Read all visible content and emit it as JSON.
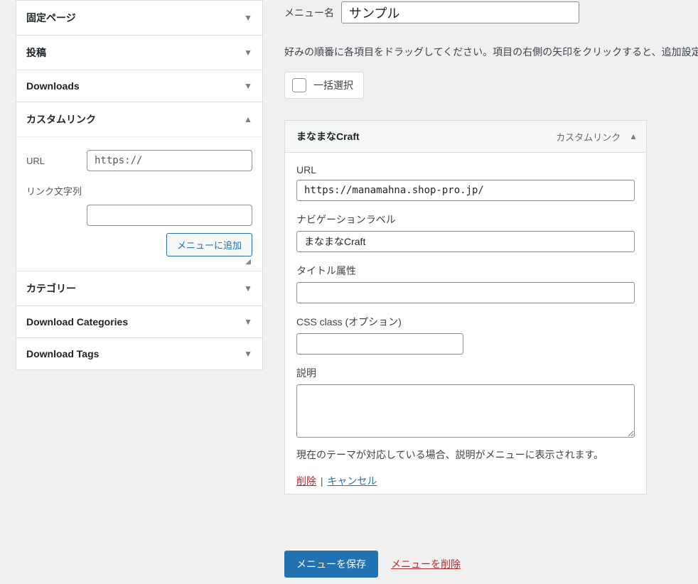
{
  "sidebar": {
    "pages": {
      "title": "固定ページ"
    },
    "posts": {
      "title": "投稿"
    },
    "downloads": {
      "title": "Downloads"
    },
    "custom_link": {
      "title": "カスタムリンク",
      "url_label": "URL",
      "url_value": "https://",
      "link_text_label": "リンク文字列",
      "link_text_value": "",
      "add_button": "メニューに追加"
    },
    "categories": {
      "title": "カテゴリー"
    },
    "download_categories": {
      "title": "Download Categories"
    },
    "download_tags": {
      "title": "Download Tags"
    }
  },
  "main": {
    "menu_name_label": "メニュー名",
    "menu_name_value": "サンプル",
    "instruction": "好みの順番に各項目をドラッグしてください。項目の右側の矢印をクリックすると、追加設定オプションを表示できます。",
    "bulk_select": "一括選択",
    "item": {
      "title": "まなまなCraft",
      "type": "カスタムリンク",
      "fields": {
        "url_label": "URL",
        "url_value": "https://manamahna.shop-pro.jp/",
        "nav_label_label": "ナビゲーションラベル",
        "nav_label_value": "まなまなCraft",
        "title_attr_label": "タイトル属性",
        "title_attr_value": "",
        "css_class_label": "CSS class (オプション)",
        "css_class_value": "",
        "description_label": "説明",
        "description_value": "",
        "description_hint": "現在のテーマが対応している場合、説明がメニューに表示されます。"
      },
      "actions": {
        "delete": "削除",
        "cancel": "キャンセル"
      }
    },
    "footer": {
      "save": "メニューを保存",
      "delete_menu": "メニューを削除"
    }
  }
}
